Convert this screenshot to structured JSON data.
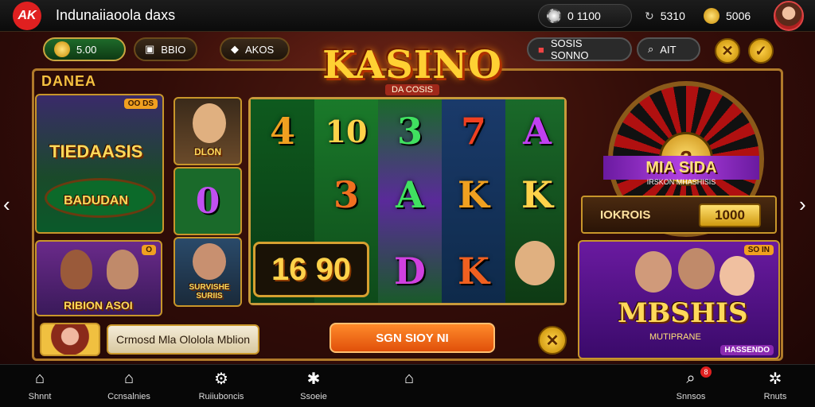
{
  "header": {
    "logo_text": "AK",
    "app_title": "Indunaiiaoola daxs",
    "balance_1": "0 1100",
    "balance_2": "5310",
    "balance_3": "5006"
  },
  "toolbar": {
    "coins_value": "5.00",
    "item2_label": "BBIO",
    "item3_label": "AKOS",
    "item4_label": "SOSIS SONNO",
    "item5_label": "AIT",
    "close_symbol": "✕",
    "check_symbol": "✓"
  },
  "main": {
    "section_title": "DANEA",
    "kasino_title": "KASINO",
    "kasino_sub": "DA COSIS",
    "left_cards": [
      {
        "title": "TIEDAASIS",
        "badge": "OO DS",
        "sub": "BADUDAN"
      },
      {
        "title": "RIBION ASOI",
        "badge": "O"
      }
    ],
    "char_cards": [
      {
        "label": "DLON"
      },
      {
        "label": "SURVISHE SURIIS"
      }
    ],
    "reels": [
      [
        "4",
        "0",
        "16"
      ],
      [
        "10",
        "3",
        "90"
      ],
      [
        "3",
        "A",
        "D"
      ],
      [
        "7",
        "K",
        "K"
      ],
      [
        "A",
        "K",
        ""
      ]
    ],
    "jackpot_1": "16",
    "jackpot_2": "90",
    "roulette_center": "2",
    "roulette_title": "MIA SIDA",
    "roulette_sub": "IRSKON MHASHISIS",
    "tokens_label": "IOKROIS",
    "tokens_value": "1000",
    "promo_card_title": "MBSHIS",
    "promo_card_sub": "MUTIPRANE",
    "promo_card_badge": "SO IN",
    "promo_card_tag": "HASSENDO",
    "promo_text": "Crmosd Mla Ololola Mblion",
    "cta_label": "SGN SIOY NI",
    "dismiss_symbol": "✕"
  },
  "nav": [
    {
      "label": "Shnnt",
      "icon": "home-icon"
    },
    {
      "label": "Ccnsalnies",
      "icon": "store-icon"
    },
    {
      "label": "Ruiiuboncis",
      "icon": "settings-icon"
    },
    {
      "label": "Ssoeie",
      "icon": "star-icon"
    },
    {
      "label": "",
      "icon": "home-outline-icon"
    },
    {
      "label": "Snnsos",
      "icon": "search-icon",
      "badge": "8"
    },
    {
      "label": "Rnuts",
      "icon": "gear-icon"
    }
  ],
  "colors": {
    "accent": "#f5c040",
    "brand": "#e02020"
  }
}
